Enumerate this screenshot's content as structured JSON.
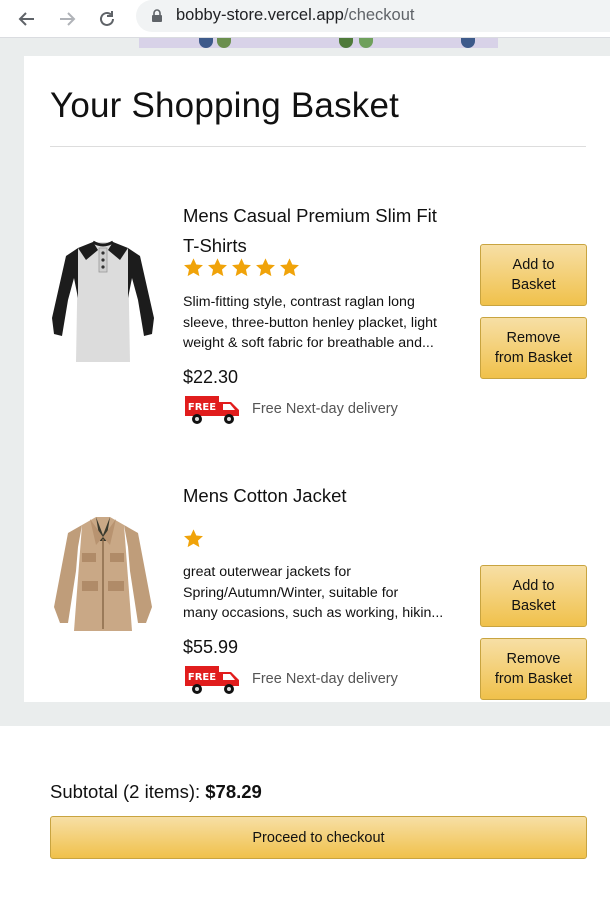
{
  "browser": {
    "url_host": "bobby-store.vercel.app",
    "url_path": "/checkout"
  },
  "basket": {
    "title": "Your Shopping Basket",
    "products": [
      {
        "title_line1": "Mens Casual Premium Slim Fit",
        "title_line2": "T-Shirts",
        "rating": 5,
        "description_lines": [
          "Slim-fitting style, contrast raglan long",
          "sleeve, three-button henley placket, light",
          "weight & soft fabric for breathable and..."
        ],
        "price": "$22.30",
        "delivery": "Free Next-day delivery",
        "add_label": "Add to Basket",
        "remove_label": "Remove from Basket",
        "image_icon": "tshirt-image"
      },
      {
        "title_line1": "Mens Cotton Jacket",
        "title_line2": "",
        "rating": 1,
        "description_lines": [
          "great outerwear jackets for",
          "Spring/Autumn/Winter, suitable for",
          "many occasions, such as working, hikin..."
        ],
        "price": "$55.99",
        "delivery": "Free Next-day delivery",
        "add_label": "Add to Basket",
        "remove_label": "Remove from Basket",
        "image_icon": "jacket-image"
      }
    ]
  },
  "free_badge_text": "FREE",
  "subtotal": {
    "label": "Subtotal (2 items):",
    "amount": "$78.29"
  },
  "checkout_label": "Proceed to checkout",
  "colors": {
    "button_gradient_top": "#f7dfa5",
    "button_gradient_bottom": "#f0c14b",
    "star": "#f0a30a",
    "page_background": "#eaeded"
  }
}
